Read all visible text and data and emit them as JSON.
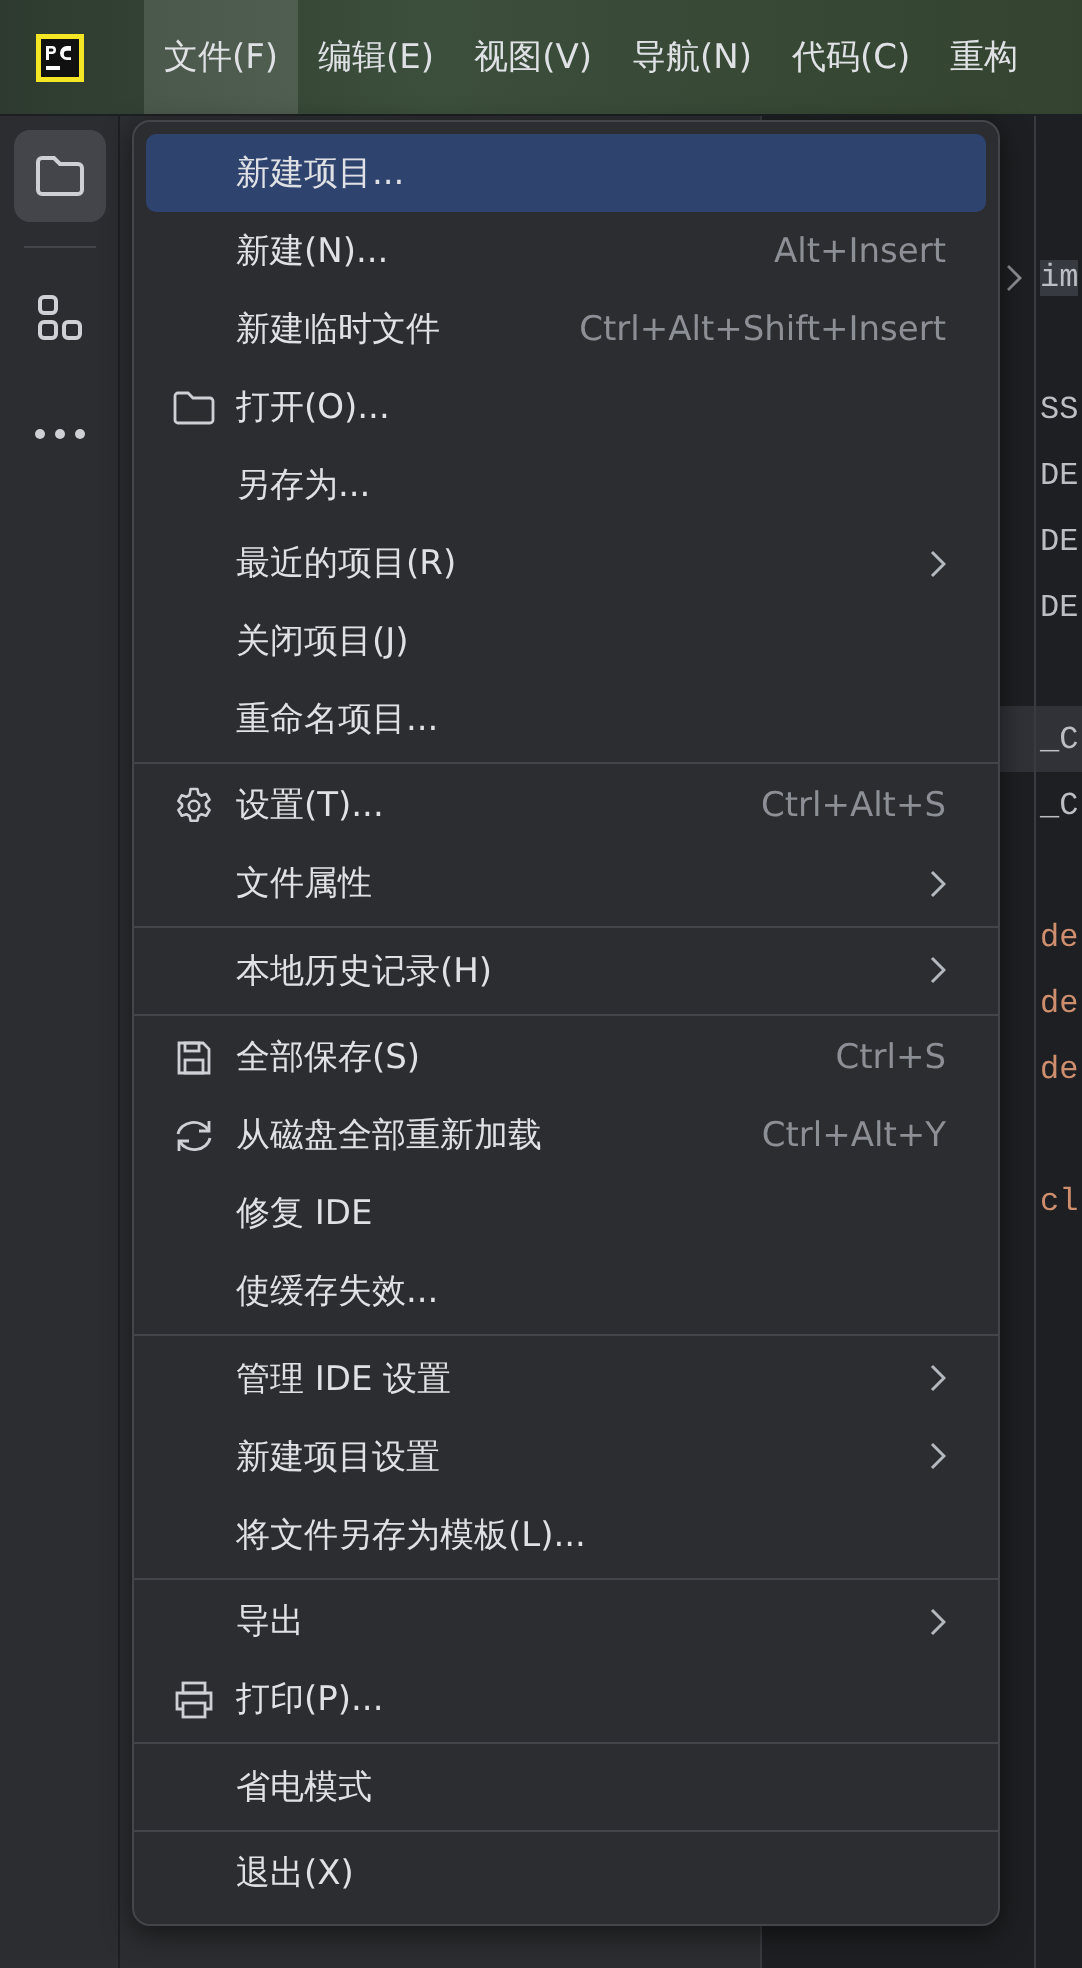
{
  "menubar": [
    {
      "label": "文件(F)",
      "selected": true
    },
    {
      "label": "编辑(E)",
      "selected": false
    },
    {
      "label": "视图(V)",
      "selected": false
    },
    {
      "label": "导航(N)",
      "selected": false
    },
    {
      "label": "代码(C)",
      "selected": false
    },
    {
      "label": "重构",
      "selected": false
    }
  ],
  "sidebar": [
    {
      "kind": "folder",
      "selected": true
    },
    {
      "kind": "structure",
      "selected": false
    },
    {
      "kind": "more",
      "selected": false
    }
  ],
  "editor": {
    "lines": [
      {
        "kind": "code",
        "text": "im",
        "highlighted": true,
        "current": false,
        "fold": true
      },
      {
        "kind": "blank",
        "current": false
      },
      {
        "kind": "code",
        "text": "SS",
        "highlighted": false,
        "current": false
      },
      {
        "kind": "code",
        "text": "DE",
        "highlighted": false,
        "current": false
      },
      {
        "kind": "code",
        "text": "DE",
        "highlighted": false,
        "current": false
      },
      {
        "kind": "code",
        "text": "DE",
        "highlighted": false,
        "current": false
      },
      {
        "kind": "blank",
        "current": false
      },
      {
        "kind": "code",
        "text": "_C",
        "highlighted": false,
        "current": true
      },
      {
        "kind": "code",
        "text": "_C",
        "highlighted": false,
        "current": false
      },
      {
        "kind": "blank",
        "current": false
      },
      {
        "kind": "keyword",
        "text": "de",
        "highlighted": false,
        "current": false
      },
      {
        "kind": "keyword",
        "text": "de",
        "highlighted": false,
        "current": false
      },
      {
        "kind": "keyword",
        "text": "de",
        "highlighted": false,
        "current": false
      },
      {
        "kind": "blank",
        "current": false
      },
      {
        "kind": "keyword",
        "text": "cl",
        "highlighted": false,
        "current": false
      }
    ]
  },
  "menu": {
    "groups": [
      [
        {
          "label": "新建项目...",
          "kind": "plain",
          "selected": true,
          "submenu": false
        },
        {
          "label": "新建(N)...",
          "shortcut": "Alt+Insert",
          "kind": "plain",
          "selected": false,
          "submenu": false
        },
        {
          "label": "新建临时文件",
          "shortcut": "Ctrl+Alt+Shift+Insert",
          "kind": "plain",
          "selected": false,
          "submenu": false
        },
        {
          "label": "打开(O)...",
          "kind": "folder",
          "selected": false,
          "submenu": false
        },
        {
          "label": "另存为...",
          "kind": "plain",
          "selected": false,
          "submenu": false
        },
        {
          "label": "最近的项目(R)",
          "kind": "plain",
          "selected": false,
          "submenu": true
        },
        {
          "label": "关闭项目(J)",
          "kind": "plain",
          "selected": false,
          "submenu": false
        },
        {
          "label": "重命名项目...",
          "kind": "plain",
          "selected": false,
          "submenu": false
        }
      ],
      [
        {
          "label": "设置(T)...",
          "shortcut": "Ctrl+Alt+S",
          "kind": "settings",
          "selected": false,
          "submenu": false
        },
        {
          "label": "文件属性",
          "kind": "plain",
          "selected": false,
          "submenu": true
        }
      ],
      [
        {
          "label": "本地历史记录(H)",
          "kind": "plain",
          "selected": false,
          "submenu": true
        }
      ],
      [
        {
          "label": "全部保存(S)",
          "shortcut": "Ctrl+S",
          "kind": "save",
          "selected": false,
          "submenu": false
        },
        {
          "label": "从磁盘全部重新加载",
          "shortcut": "Ctrl+Alt+Y",
          "kind": "reload",
          "selected": false,
          "submenu": false
        },
        {
          "label": "修复 IDE",
          "kind": "plain",
          "selected": false,
          "submenu": false
        },
        {
          "label": "使缓存失效...",
          "kind": "plain",
          "selected": false,
          "submenu": false
        }
      ],
      [
        {
          "label": "管理 IDE 设置",
          "kind": "plain",
          "selected": false,
          "submenu": true
        },
        {
          "label": "新建项目设置",
          "kind": "plain",
          "selected": false,
          "submenu": true
        },
        {
          "label": "将文件另存为模板(L)...",
          "kind": "plain",
          "selected": false,
          "submenu": false
        }
      ],
      [
        {
          "label": "导出",
          "kind": "plain",
          "selected": false,
          "submenu": true
        },
        {
          "label": "打印(P)...",
          "kind": "print",
          "selected": false,
          "submenu": false
        }
      ],
      [
        {
          "label": "省电模式",
          "kind": "plain",
          "selected": false,
          "submenu": false
        }
      ],
      [
        {
          "label": "退出(X)",
          "kind": "plain",
          "selected": false,
          "submenu": false
        }
      ]
    ]
  }
}
